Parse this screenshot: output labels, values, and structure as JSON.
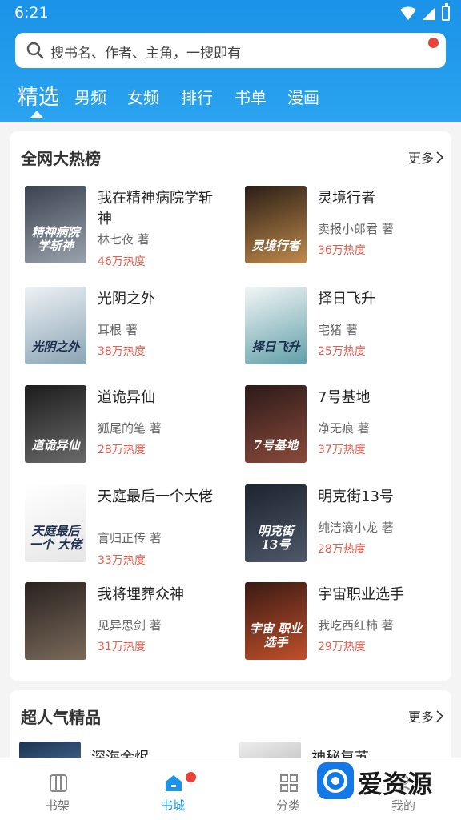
{
  "status_bar": {
    "time": "6:21"
  },
  "search": {
    "placeholder": "搜书名、作者、主角，一搜即有"
  },
  "tabs": [
    {
      "label": "精选",
      "active": true
    },
    {
      "label": "男频"
    },
    {
      "label": "女频"
    },
    {
      "label": "排行"
    },
    {
      "label": "书单"
    },
    {
      "label": "漫画"
    }
  ],
  "hot_list": {
    "title": "全网大热榜",
    "more": "更多",
    "books": [
      {
        "title": "我在精神病院学斩神",
        "author": "林七夜 著",
        "heat": "46万热度",
        "cover_text": "精神病院 学斩神",
        "cover_colors": [
          "#3b4250",
          "#9aa3ad"
        ]
      },
      {
        "title": "灵境行者",
        "author": "卖报小郎君 著",
        "heat": "36万热度",
        "cover_text": "灵境行者",
        "cover_colors": [
          "#2a1e17",
          "#c08a4a"
        ]
      },
      {
        "title": "光阴之外",
        "author": "耳根 著",
        "heat": "38万热度",
        "cover_text": "光阴之外",
        "cover_colors": [
          "#eef2f5",
          "#8aa3b4"
        ]
      },
      {
        "title": "择日飞升",
        "author": "宅猪 著",
        "heat": "25万热度",
        "cover_text": "择日飞升",
        "cover_colors": [
          "#f3f6f6",
          "#5f9fa8"
        ]
      },
      {
        "title": "道诡异仙",
        "author": "狐尾的笔 著",
        "heat": "28万热度",
        "cover_text": "道诡异仙",
        "cover_colors": [
          "#1c1c1c",
          "#6a6a6a"
        ]
      },
      {
        "title": "7号基地",
        "author": "净无痕 著",
        "heat": "37万热度",
        "cover_text": "7号基地",
        "cover_colors": [
          "#2c1a1a",
          "#8a4a3a"
        ]
      },
      {
        "title": "天庭最后一个大佬",
        "author": "言归正传 著",
        "heat": "33万热度",
        "cover_text": "天庭最后一个 大佬",
        "cover_colors": [
          "#ffffff",
          "#e6e6e6"
        ]
      },
      {
        "title": "明克街13号",
        "author": "纯洁滴小龙 著",
        "heat": "28万热度",
        "cover_text": "明克街 13号",
        "cover_colors": [
          "#1e2430",
          "#4e5868"
        ]
      },
      {
        "title": "我将埋葬众神",
        "author": "见异思剑 著",
        "heat": "31万热度",
        "cover_text": "",
        "cover_colors": [
          "#2a2220",
          "#7a6a5a"
        ]
      },
      {
        "title": "宇宙职业选手",
        "author": "我吃西红柿 著",
        "heat": "29万热度",
        "cover_text": "宇宙 职业选手",
        "cover_colors": [
          "#3a1a14",
          "#c0502a"
        ]
      }
    ]
  },
  "popular": {
    "title": "超人气精品",
    "more": "更多",
    "peek": [
      {
        "title": "深海余烬",
        "cover_colors": [
          "#1d3350",
          "#3a5a80"
        ]
      },
      {
        "title": "神秘复苏",
        "cover_colors": [
          "#eeeeee",
          "#cccccc"
        ]
      }
    ]
  },
  "bottom_nav": [
    {
      "label": "书架",
      "icon": "bookshelf-icon"
    },
    {
      "label": "书城",
      "icon": "home-icon",
      "active": true,
      "badge": true
    },
    {
      "label": "分类",
      "icon": "category-grid-icon"
    },
    {
      "label": "我的",
      "icon": "profile-icon"
    }
  ],
  "watermark": {
    "text": "爱资源"
  }
}
